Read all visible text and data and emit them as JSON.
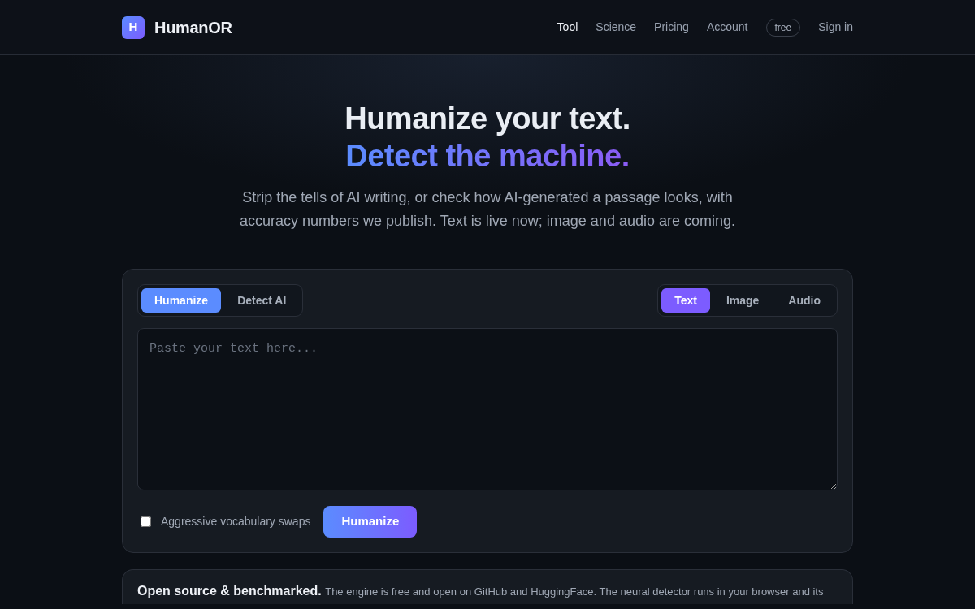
{
  "brand": {
    "logo_letter": "H",
    "name": "HumanOR"
  },
  "nav": {
    "links": [
      {
        "label": "Tool",
        "selected": true
      },
      {
        "label": "Science",
        "selected": false
      },
      {
        "label": "Pricing",
        "selected": false
      },
      {
        "label": "Account",
        "selected": false
      }
    ],
    "plan_badge": "free",
    "sign_in": "Sign in"
  },
  "hero": {
    "title_line_1": "Humanize your text.",
    "title_line_2": "Detect the machine.",
    "subtitle": "Strip the tells of AI writing, or check how AI-generated a passage looks, with accuracy numbers we publish. Text is live now; image and audio are coming."
  },
  "tool": {
    "modes": [
      {
        "label": "Humanize",
        "selected": true
      },
      {
        "label": "Detect AI",
        "selected": false
      }
    ],
    "media": [
      {
        "label": "Text",
        "selected": true
      },
      {
        "label": "Image",
        "selected": false
      },
      {
        "label": "Audio",
        "selected": false
      }
    ],
    "input": {
      "placeholder": "Paste your text here..."
    },
    "option": {
      "label": "Aggressive vocabulary swaps",
      "checked": false
    },
    "submit": "Humanize"
  },
  "info": {
    "title": "Open source & benchmarked.",
    "text": "The engine is free and open on GitHub and HuggingFace. The neural detector runs in your browser and its"
  }
}
